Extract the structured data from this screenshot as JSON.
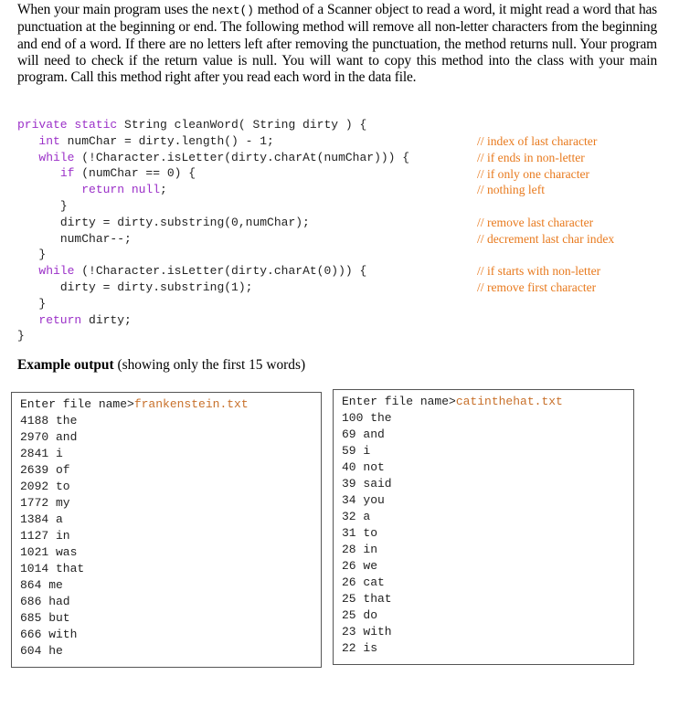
{
  "intro": {
    "before_method": "When your main program uses the ",
    "method": "next()",
    "after_method": " method of a Scanner object to read a word, it might read a word that has punctuation at the beginning or end.  The following method will remove all non-letter characters from the beginning and end of a word.  If there are no letters left after removing the punctuation, the method returns null.  Your program will need to check if the return value is null.  You will want to copy this method into the class with your main program.  Call this method right after you read each word in the data file."
  },
  "code": {
    "lines": [
      {
        "indent": "",
        "kw": "private static",
        "rest": " String cleanWord( String dirty ) {"
      },
      {
        "indent": "   ",
        "kw": "int",
        "rest": " numChar = dirty.length() - 1;"
      },
      {
        "indent": "   ",
        "kw": "while",
        "rest": " (!Character.isLetter(dirty.charAt(numChar))) {"
      },
      {
        "indent": "      ",
        "kw": "if",
        "rest": " (numChar == 0) {"
      },
      {
        "indent": "         ",
        "kw": "return null",
        "rest": ";"
      },
      {
        "indent": "      ",
        "kw": "",
        "rest": "}"
      },
      {
        "indent": "      ",
        "kw": "",
        "rest": "dirty = dirty.substring(0,numChar);"
      },
      {
        "indent": "      ",
        "kw": "",
        "rest": "numChar--;"
      },
      {
        "indent": "   ",
        "kw": "",
        "rest": "}"
      },
      {
        "indent": "   ",
        "kw": "while",
        "rest": " (!Character.isLetter(dirty.charAt(0))) {"
      },
      {
        "indent": "      ",
        "kw": "",
        "rest": "dirty = dirty.substring(1);"
      },
      {
        "indent": "   ",
        "kw": "",
        "rest": "}"
      },
      {
        "indent": "   ",
        "kw": "return",
        "rest": " dirty;"
      },
      {
        "indent": "",
        "kw": "",
        "rest": "}"
      }
    ],
    "comments": [
      "// index of last character",
      "// if ends in non-letter",
      "// if only one character",
      "// nothing left",
      "",
      "// remove last character",
      "// decrement last char index",
      "",
      "// if starts with non-letter",
      "// remove first character"
    ]
  },
  "example": {
    "heading_bold": "Example output",
    "heading_rest": " (showing only the first 15 words)"
  },
  "outputs": [
    {
      "prompt": "Enter file name>",
      "file": "frankenstein.txt",
      "lines": [
        "4188 the",
        "2970 and",
        "2841 i",
        "2639 of",
        "2092 to",
        "1772 my",
        "1384 a",
        "1127 in",
        "1021 was",
        "1014 that",
        "864 me",
        "686 had",
        "685 but",
        "666 with",
        "604 he"
      ]
    },
    {
      "prompt": "Enter file name>",
      "file": "catinthehat.txt",
      "lines": [
        "100 the",
        "69 and",
        "59 i",
        "40 not",
        "39 said",
        "34 you",
        "32 a",
        "31 to",
        "28 in",
        "26 we",
        "26 cat",
        "25 that",
        "25 do",
        "23 with",
        "22 is"
      ]
    }
  ]
}
